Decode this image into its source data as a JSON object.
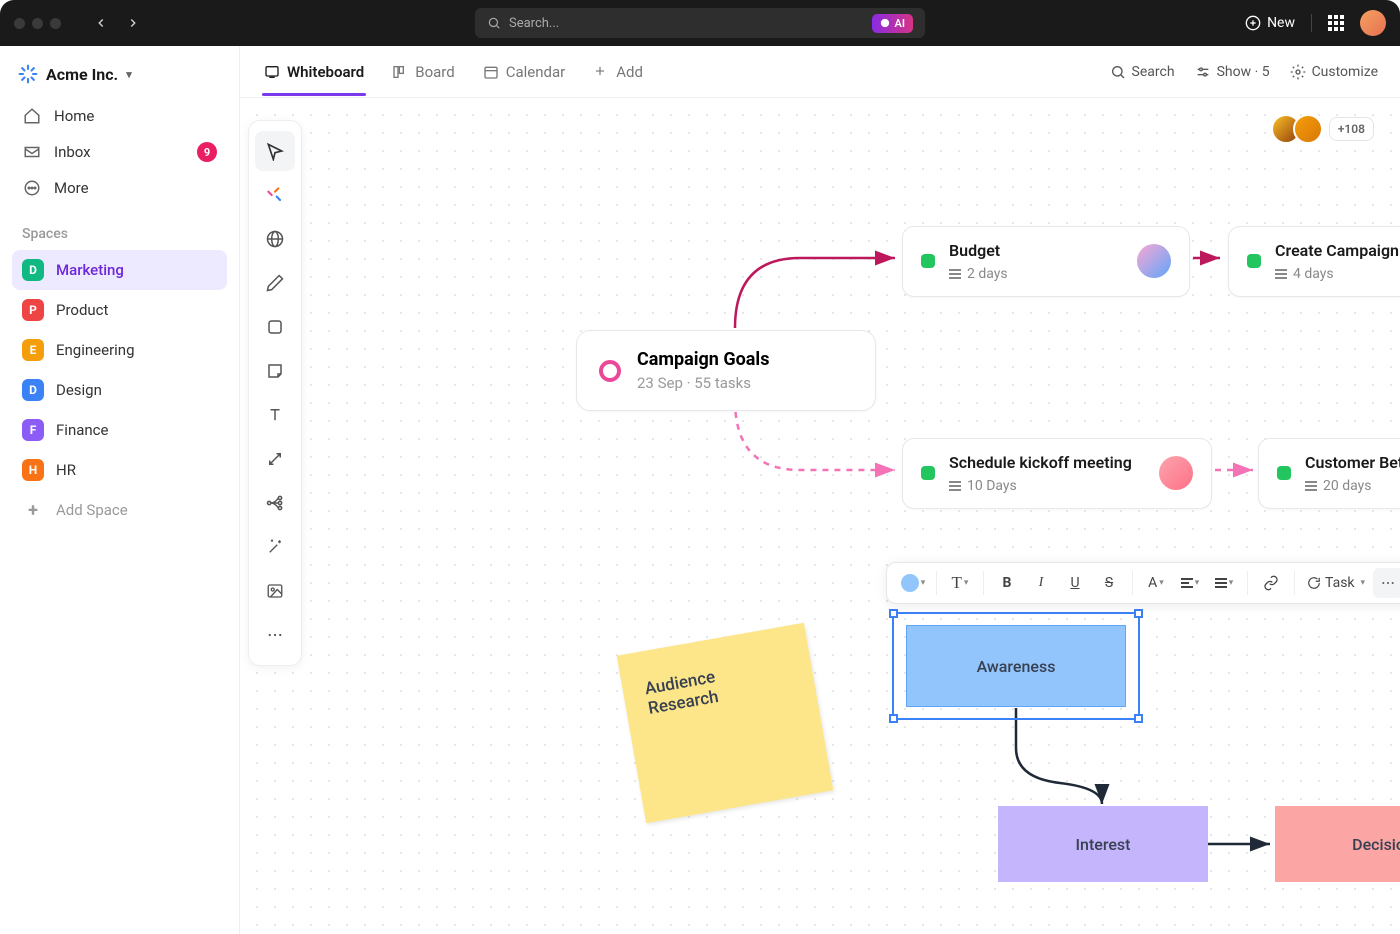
{
  "titlebar": {
    "search_placeholder": "Search...",
    "ai_label": "AI",
    "new_label": "New"
  },
  "workspace": {
    "name": "Acme Inc."
  },
  "nav": {
    "home": "Home",
    "inbox": "Inbox",
    "inbox_badge": "9",
    "more": "More"
  },
  "spaces": {
    "label": "Spaces",
    "items": [
      {
        "letter": "D",
        "name": "Marketing",
        "color": "#10b981",
        "active": true
      },
      {
        "letter": "P",
        "name": "Product",
        "color": "#ef4444"
      },
      {
        "letter": "E",
        "name": "Engineering",
        "color": "#f59e0b"
      },
      {
        "letter": "D",
        "name": "Design",
        "color": "#3b82f6"
      },
      {
        "letter": "F",
        "name": "Finance",
        "color": "#8b5cf6"
      },
      {
        "letter": "H",
        "name": "HR",
        "color": "#f97316"
      }
    ],
    "add_label": "Add Space"
  },
  "views": {
    "whiteboard": "Whiteboard",
    "board": "Board",
    "calendar": "Calendar",
    "add": "Add",
    "search": "Search",
    "show": "Show · 5",
    "customize": "Customize"
  },
  "collaborators": {
    "more_count": "+108"
  },
  "goal": {
    "title": "Campaign Goals",
    "date": "23 Sep",
    "tasks": "55 tasks"
  },
  "cards": {
    "budget": {
      "title": "Budget",
      "meta": "2 days"
    },
    "create_campaign": {
      "title": "Create Campaign",
      "meta": "4 days"
    },
    "kickoff": {
      "title": "Schedule kickoff meeting",
      "meta": "10 Days"
    },
    "customer_beta": {
      "title": "Customer Beta",
      "meta": "20 days"
    }
  },
  "sticky": {
    "text": "Audience Research"
  },
  "flow": {
    "awareness": "Awareness",
    "interest": "Interest",
    "decision": "Decision"
  },
  "rtb": {
    "task_label": "Task"
  },
  "colors": {
    "accent": "#7c3aed",
    "pink": "#ec4899"
  }
}
